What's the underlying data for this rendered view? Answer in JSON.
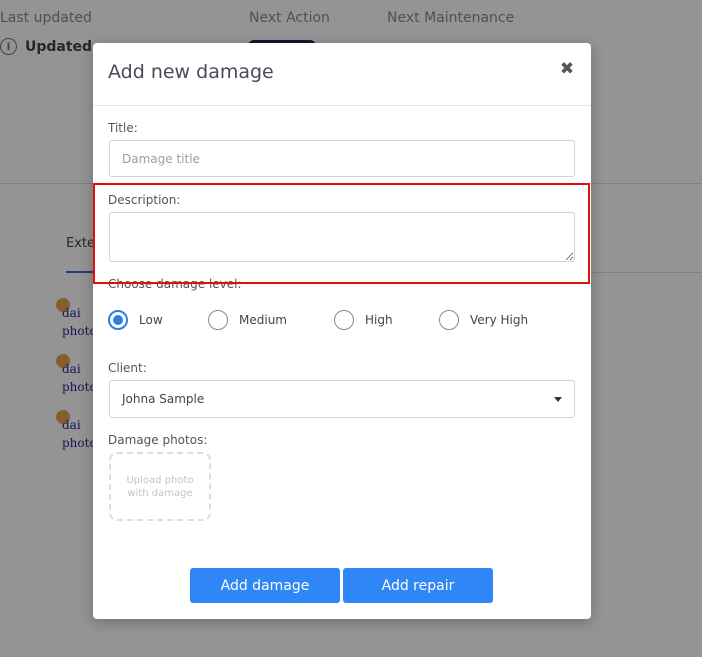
{
  "background": {
    "labels": [
      "Last updated",
      "Next Action",
      "Next Maintenance"
    ],
    "updated_text": "Updated",
    "info_icon_glyph": "i",
    "tab_label": "Exte",
    "photo_alt": [
      "dai",
      "photo"
    ]
  },
  "modal": {
    "title": "Add new damage",
    "close_glyph": "✖",
    "title_field": {
      "label": "Title:",
      "placeholder": "Damage title",
      "value": ""
    },
    "description_field": {
      "label": "Description:",
      "value": ""
    },
    "damage_level": {
      "label": "Choose damage level:",
      "options": [
        "Low",
        "Medium",
        "High",
        "Very High"
      ],
      "selected": "Low"
    },
    "client": {
      "label": "Client:",
      "value": "Johna Sample"
    },
    "photos": {
      "label": "Damage photos:",
      "upload_text": "Upload photo with damage"
    },
    "buttons": {
      "add_damage": "Add damage",
      "add_repair": "Add repair"
    }
  },
  "colors": {
    "accent": "#2f86f6",
    "radio_checked": "#2f7de1",
    "highlight": "#e01010",
    "overlay": "rgba(0,0,0,0.42)"
  },
  "icons": [
    "info-icon",
    "close-icon",
    "chevron-down-icon"
  ]
}
